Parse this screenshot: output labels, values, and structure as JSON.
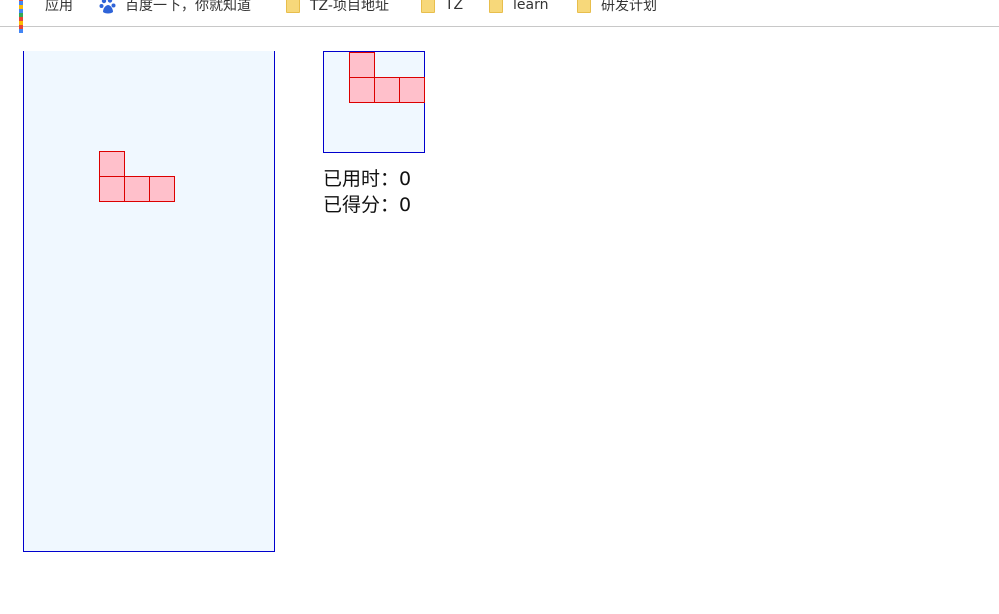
{
  "bookmarks": [
    {
      "label": "应用",
      "icon": "apps-grid-icon"
    },
    {
      "label": "百度一下，你就知道",
      "icon": "baidu-paw-icon"
    },
    {
      "label": "TZ-项目地址",
      "icon": "folder-icon"
    },
    {
      "label": "TZ",
      "icon": "folder-icon"
    },
    {
      "label": "learn",
      "icon": "folder-icon"
    },
    {
      "label": "研发计划",
      "icon": "folder-icon"
    }
  ],
  "game": {
    "board": {
      "columns": 10,
      "rows": 20,
      "background": "#f0f8ff",
      "border": "#0000cd"
    },
    "current_piece": {
      "type": "J",
      "cells": [
        [
          3,
          4
        ],
        [
          3,
          5
        ],
        [
          4,
          5
        ],
        [
          5,
          5
        ]
      ],
      "fill": "#ffc0cb",
      "stroke": "#dc0000"
    },
    "next_piece": {
      "type": "J",
      "cells": [
        [
          1,
          0
        ],
        [
          1,
          1
        ],
        [
          2,
          1
        ],
        [
          3,
          1
        ]
      ]
    },
    "stats": {
      "time_label": "已用时：",
      "time_value": "0",
      "score_label": "已得分：",
      "score_value": "0"
    }
  }
}
